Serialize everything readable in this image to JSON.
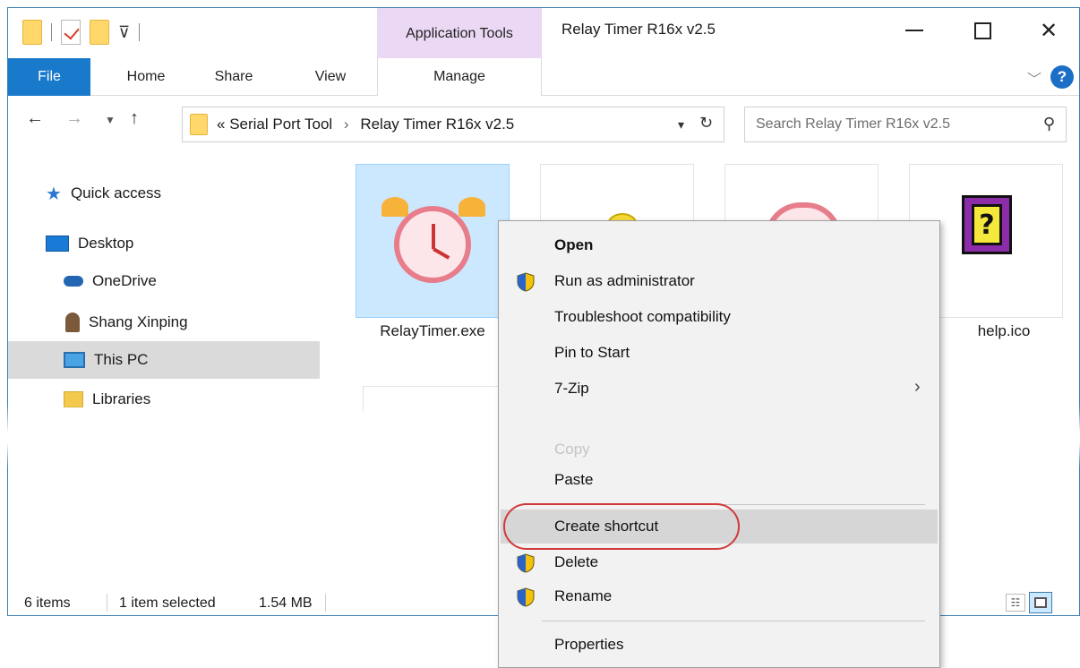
{
  "window": {
    "title": "Relay Timer R16x v2.5",
    "context_tab_header": "Application Tools"
  },
  "ribbon": {
    "tabs": [
      "File",
      "Home",
      "Share",
      "View",
      "Manage"
    ]
  },
  "address": {
    "prefix": "«",
    "crumbs": [
      "Serial Port Tool",
      "Relay Timer R16x v2.5"
    ],
    "separator": "›"
  },
  "search": {
    "placeholder": "Search Relay Timer R16x v2.5"
  },
  "nav_pane": {
    "items": [
      {
        "label": "Quick access",
        "icon": "star-icon"
      },
      {
        "label": "Desktop",
        "icon": "desktop-icon"
      },
      {
        "label": "OneDrive",
        "icon": "cloud-icon"
      },
      {
        "label": "Shang Xinping",
        "icon": "user-icon"
      },
      {
        "label": "This PC",
        "icon": "computer-icon",
        "selected": true
      },
      {
        "label": "Libraries",
        "icon": "library-icon"
      }
    ]
  },
  "files": [
    {
      "name": "RelayTimer.exe",
      "icon": "alarm-clock-icon",
      "selected": true
    },
    {
      "name": "",
      "icon": "bulb-icon"
    },
    {
      "name": "",
      "icon": "alarm-clock-icon"
    },
    {
      "name": "help.ico",
      "icon": "help-icon"
    }
  ],
  "status": {
    "item_count": "6 items",
    "selection": "1 item selected",
    "size": "1.54 MB"
  },
  "context_menu": {
    "items": {
      "open": "Open",
      "run_admin": "Run as administrator",
      "troubleshoot": "Troubleshoot compatibility",
      "pin_start": "Pin to Start",
      "zip": "7-Zip",
      "copy": "Copy",
      "paste": "Paste",
      "create_shortcut": "Create shortcut",
      "delete": "Delete",
      "rename": "Rename",
      "properties": "Properties"
    },
    "highlight_color": "#d03a3a"
  }
}
